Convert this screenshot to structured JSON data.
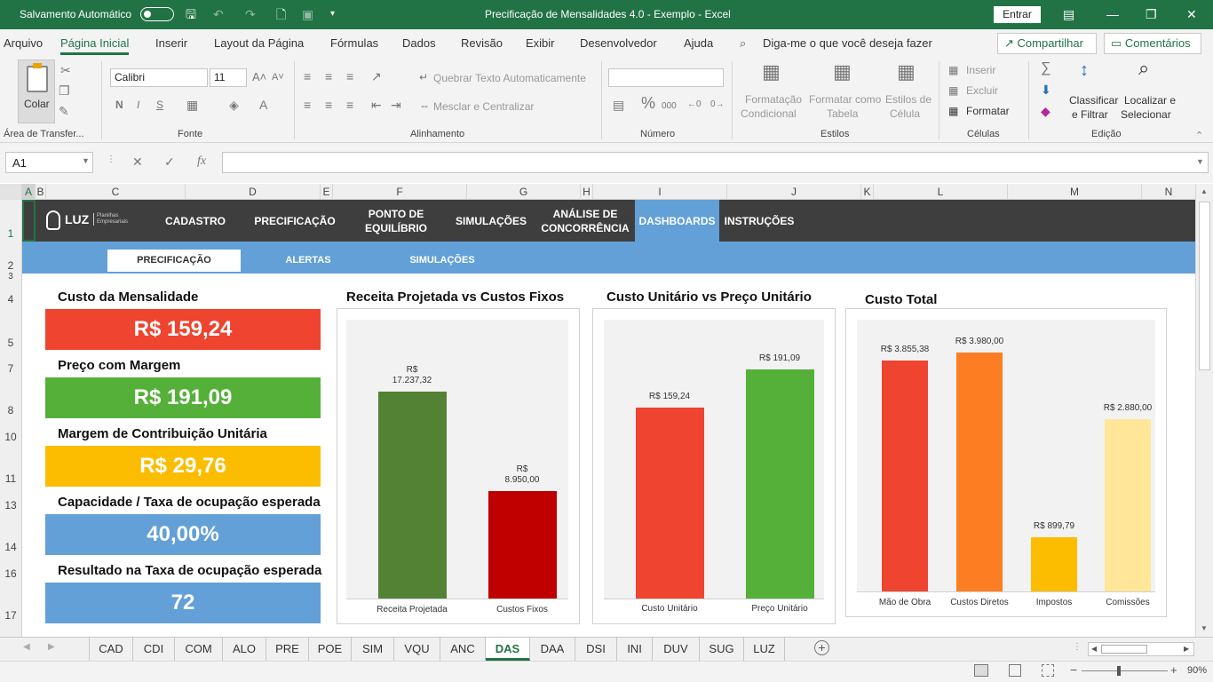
{
  "titlebar": {
    "autosave_label": "Salvamento Automático",
    "title": "Precificação de Mensalidades 4.0 - Exemplo  -  Excel",
    "signin": "Entrar"
  },
  "menu": {
    "items": [
      "Arquivo",
      "Página Inicial",
      "Inserir",
      "Layout da Página",
      "Fórmulas",
      "Dados",
      "Revisão",
      "Exibir",
      "Desenvolvedor",
      "Ajuda"
    ],
    "active": "Página Inicial",
    "tellme": "Diga-me o que você deseja fazer",
    "share": "Compartilhar",
    "comments": "Comentários"
  },
  "ribbon": {
    "clipboard": {
      "paste": "Colar",
      "label": "Área de Transfer..."
    },
    "font": {
      "name": "Calibri",
      "size": "11",
      "bold": "N",
      "italic": "I",
      "underline": "S",
      "label": "Fonte"
    },
    "alignment": {
      "wrap": "Quebrar Texto Automaticamente",
      "merge": "Mesclar e Centralizar",
      "label": "Alinhamento"
    },
    "number": {
      "format": "",
      "label": "Número"
    },
    "styles": {
      "conditional_1": "Formatação",
      "conditional_2": "Condicional",
      "table_1": "Formatar como",
      "table_2": "Tabela",
      "cell_1": "Estilos de",
      "cell_2": "Célula",
      "label": "Estilos"
    },
    "cells": {
      "insert": "Inserir",
      "delete": "Excluir",
      "format": "Formatar",
      "label": "Células"
    },
    "editing": {
      "sort_1": "Classificar",
      "sort_2": "e Filtrar",
      "find_1": "Localizar e",
      "find_2": "Selecionar",
      "label": "Edição"
    }
  },
  "formula_bar": {
    "name_box": "A1",
    "formula": ""
  },
  "columns": [
    "A",
    "B",
    "C",
    "D",
    "E",
    "F",
    "G",
    "H",
    "I",
    "J",
    "K",
    "L",
    "M",
    "N"
  ],
  "rows": [
    "1",
    "2",
    "3",
    "4",
    "5",
    "7",
    "8",
    "10",
    "11",
    "13",
    "14",
    "16",
    "17"
  ],
  "sheet": {
    "logo": {
      "text": "LUZ",
      "sub1": "Planilhas",
      "sub2": "Empresariais"
    },
    "nav": [
      {
        "l1": "CADASTRO",
        "l2": ""
      },
      {
        "l1": "PRECIFICAÇÃO",
        "l2": ""
      },
      {
        "l1": "PONTO DE",
        "l2": "EQUILÍBRIO"
      },
      {
        "l1": "SIMULAÇÕES",
        "l2": ""
      },
      {
        "l1": "ANÁLISE DE",
        "l2": "CONCORRÊNCIA"
      },
      {
        "l1": "DASHBOARDS",
        "l2": ""
      },
      {
        "l1": "INSTRUÇÕES",
        "l2": ""
      }
    ],
    "nav_active": "DASHBOARDS",
    "subnav": [
      "PRECIFICAÇÃO",
      "ALERTAS",
      "SIMULAÇÕES"
    ],
    "subnav_active": "PRECIFICAÇÃO",
    "kpis": [
      {
        "label": "Custo da Mensalidade",
        "value": "R$ 159,24",
        "color": "#ee4430"
      },
      {
        "label": "Preço com Margem",
        "value": "R$ 191,09",
        "color": "#55b03a"
      },
      {
        "label": "Margem de Contribuição Unitária",
        "value": "R$ 29,76",
        "color": "#fcbd00"
      },
      {
        "label": "Capacidade / Taxa de ocupação esperada",
        "value": "40,00%",
        "color": "#62a0d7"
      },
      {
        "label": "Resultado na Taxa de ocupação esperada",
        "value": "72",
        "color": "#62a0d7"
      }
    ]
  },
  "chart_data": [
    {
      "type": "bar",
      "title": "Receita Projetada vs Custos Fixos",
      "categories": [
        "Receita Projetada",
        "Custos Fixos"
      ],
      "values": [
        17237.32,
        8950.0
      ],
      "data_labels": [
        [
          "R$",
          "17.237,32"
        ],
        [
          "R$",
          "8.950,00"
        ]
      ],
      "colors": [
        "#538234",
        "#c00000"
      ],
      "ylim": [
        0,
        20000
      ],
      "grid": false
    },
    {
      "type": "bar",
      "title": "Custo Unitário vs Preço Unitário",
      "categories": [
        "Custo Unitário",
        "Preço Unitário"
      ],
      "values": [
        159.24,
        191.09
      ],
      "data_labels": [
        [
          "R$ 159,24"
        ],
        [
          "R$ 191,09"
        ]
      ],
      "colors": [
        "#ee4430",
        "#55b03a"
      ],
      "ylim": [
        0,
        200
      ],
      "grid": false
    },
    {
      "type": "bar",
      "title": "Custo Total",
      "categories": [
        "Mão de Obra",
        "Custos Diretos",
        "Impostos",
        "Comissões"
      ],
      "values": [
        3855.38,
        3980.0,
        899.79,
        2880.0
      ],
      "data_labels": [
        [
          "R$ 3.855,38"
        ],
        [
          "R$ 3.980,00"
        ],
        [
          "R$ 899,79"
        ],
        [
          "R$ 2.880,00"
        ]
      ],
      "colors": [
        "#ee4430",
        "#fd7e22",
        "#fcbd00",
        "#ffe699"
      ],
      "ylim": [
        0,
        4000
      ],
      "grid": false
    }
  ],
  "sheet_tabs": [
    "CAD",
    "CDI",
    "COM",
    "ALO",
    "PRE",
    "POE",
    "SIM",
    "VQU",
    "ANC",
    "DAS",
    "DAA",
    "DSI",
    "INI",
    "DUV",
    "SUG",
    "LUZ"
  ],
  "active_tab": "DAS",
  "status": {
    "zoom": "90%"
  }
}
